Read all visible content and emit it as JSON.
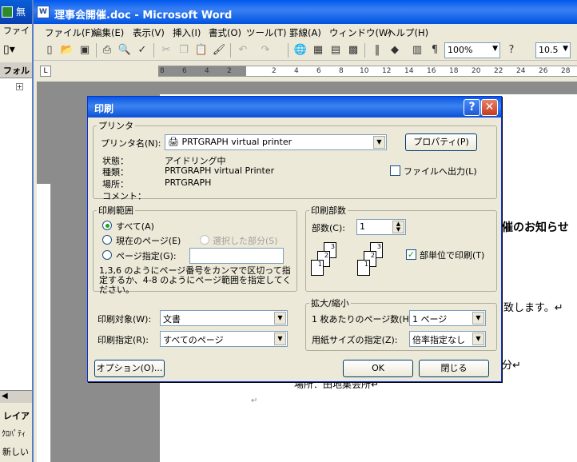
{
  "background_window": {
    "title": "無",
    "menu_item": "ファイ",
    "panel_title": "フォル",
    "tab_label": "レイア",
    "tab2_label": "ｸﾛﾊﾟﾃｨ",
    "tab3_label": "新しい"
  },
  "word": {
    "title": "理事会開催.doc - Microsoft Word",
    "icon_text": "W",
    "menu": [
      "ファイル(F)",
      "編集(E)",
      "表示(V)",
      "挿入(I)",
      "書式(O)",
      "ツール(T)",
      "罫線(A)",
      "ウィンドウ(W)",
      "ヘルプ(H)"
    ],
    "toolbar": {
      "zoom": "100%",
      "font_size": "10.5"
    },
    "ruler_numbers": [
      "8",
      "6",
      "4",
      "2",
      "2",
      "4",
      "6",
      "8",
      "10",
      "12",
      "14",
      "16",
      "18",
      "20",
      "22",
      "24",
      "26",
      "28"
    ],
    "document": {
      "heading_fragment": "催のお知らせ",
      "line1_fragment": "致します。↵",
      "line2_fragment": "分↵",
      "line3_fragment": "場所：田地集会所↵",
      "line4_fragment": "↵"
    }
  },
  "dialog": {
    "title": "印刷",
    "help": "?",
    "close": "✕",
    "printer_group": {
      "legend": "プリンタ",
      "name_label": "プリンタ名(N):",
      "name_value": "PRTGRAPH virtual printer",
      "properties_button": "プロパティ(P)",
      "status_label": "状態：",
      "status_value": "アイドリング中",
      "type_label": "種類：",
      "type_value": "PRTGRAPH virtual Printer",
      "where_label": "場所：",
      "where_value": "PRTGRAPH",
      "comment_label": "コメント：",
      "print_to_file": "ファイルへ出力(L)",
      "print_to_file_checked": false
    },
    "range_group": {
      "legend": "印刷範囲",
      "all": "すべて(A)",
      "current_page": "現在のページ(E)",
      "selection": "選択した部分(S)",
      "pages": "ページ指定(G):",
      "pages_value": "",
      "hint": "1,3,6 のようにページ番号をカンマで区切って指定するか、4-8 のようにページ範囲を指定してください。",
      "selected": "all"
    },
    "copies_group": {
      "legend": "印刷部数",
      "copies_label": "部数(C):",
      "copies_value": "1",
      "collate": "部単位で印刷(T)",
      "collate_checked": true
    },
    "print_what_label": "印刷対象(W):",
    "print_what_value": "文書",
    "print_label": "印刷指定(R):",
    "print_value": "すべてのページ",
    "zoom_group": {
      "legend": "拡大/縮小",
      "pages_per_sheet_label": "1 枚あたりのページ数(H):",
      "pages_per_sheet_value": "1 ページ",
      "scale_label": "用紙サイズの指定(Z):",
      "scale_value": "倍率指定なし"
    },
    "options_button": "オプション(O)...",
    "ok_button": "OK",
    "cancel_button": "閉じる"
  }
}
